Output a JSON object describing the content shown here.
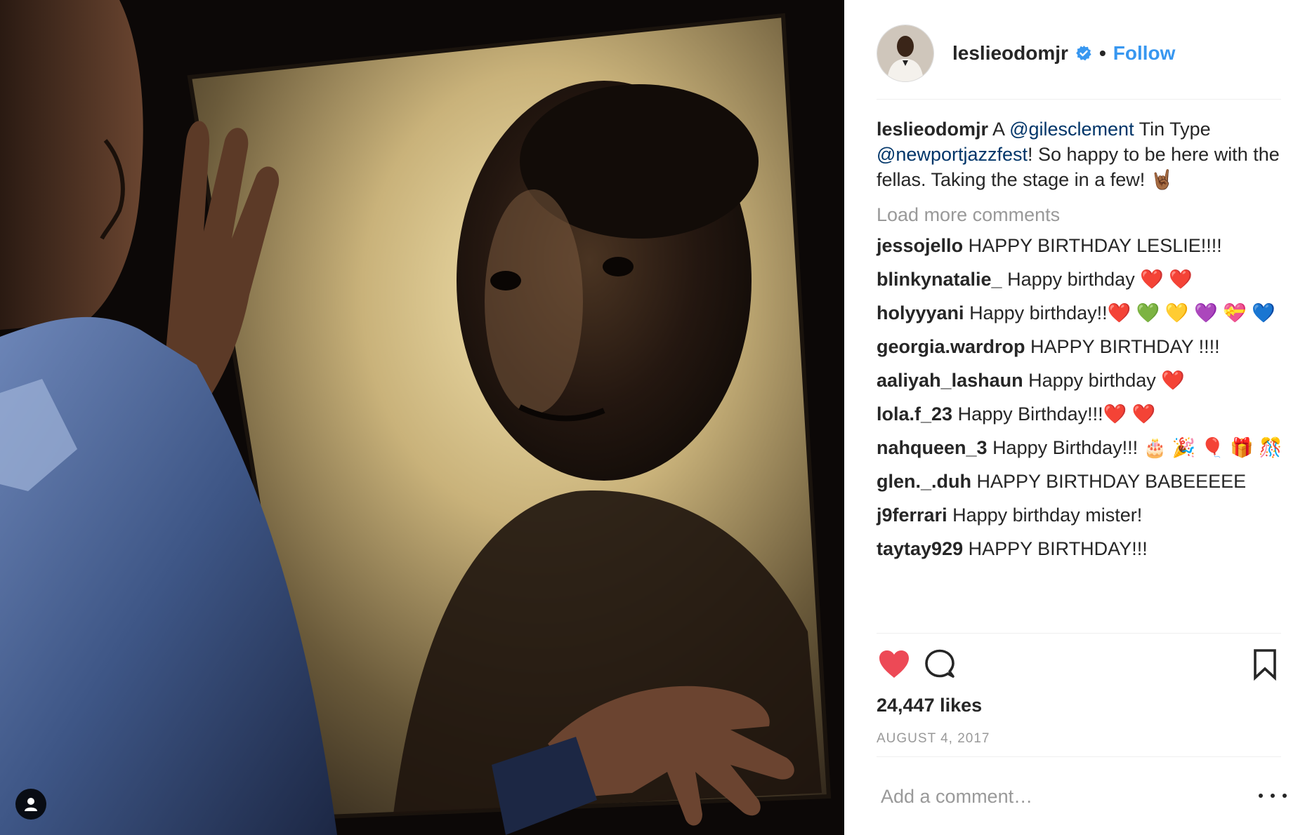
{
  "post": {
    "username": "leslieodomjr",
    "follow_label": "Follow",
    "separator": "•",
    "caption": {
      "username": "leslieodomjr",
      "text_1": " A ",
      "mention_1": "@gilesclement",
      "text_2": " Tin Type ",
      "mention_2": "@newportjazzfest",
      "text_3": "! So happy to be here with the fellas. Taking the stage in a few! 🤘🏾"
    },
    "load_more_label": "Load more comments",
    "comments": [
      {
        "user": "jessojello",
        "text": "HAPPY BIRTHDAY LESLIE!!!!"
      },
      {
        "user": "blinkynatalie_",
        "text": "Happy birthday ❤️ ❤️"
      },
      {
        "user": "holyyyani",
        "text": "Happy birthday!!❤️ 💚 💛 💜 💝 💙"
      },
      {
        "user": "georgia.wardrop",
        "text": "HAPPY BIRTHDAY !!!!"
      },
      {
        "user": "aaliyah_lashaun",
        "text": "Happy birthday ❤️"
      },
      {
        "user": "lola.f_23",
        "text": "Happy Birthday!!!❤️ ❤️"
      },
      {
        "user": "nahqueen_3",
        "text": "Happy Birthday!!! 🎂 🎉 🎈 🎁 🎊"
      },
      {
        "user": "glen._.duh",
        "text": "HAPPY BIRTHDAY BABEEEEE"
      },
      {
        "user": "j9ferrari",
        "text": "Happy birthday mister!"
      },
      {
        "user": "taytay929",
        "text": "HAPPY BIRTHDAY!!!"
      }
    ],
    "likes": "24,447 likes",
    "date": "AUGUST 4, 2017",
    "add_comment_placeholder": "Add a comment…",
    "icons": {
      "like": "heart-icon",
      "comment": "comment-icon",
      "save": "bookmark-icon",
      "more": "more-options-icon",
      "verified": "verified-badge-icon",
      "tagged": "user-tag-icon"
    },
    "colors": {
      "like_red": "#ed4956",
      "follow_blue": "#3897f0",
      "mention_blue": "#003569",
      "muted_gray": "#999999",
      "text_dark": "#262626"
    }
  }
}
